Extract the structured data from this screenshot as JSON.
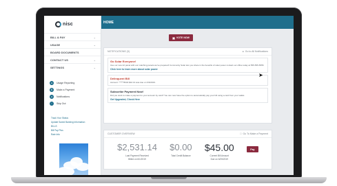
{
  "app": {
    "logo_text": "nisc",
    "page_title": "HOME"
  },
  "colors": {
    "brand_teal": "#1f6e8c",
    "accent_maroon": "#8b2a3e",
    "alert_red": "#c0392b"
  },
  "sidebar": {
    "nav_items": [
      {
        "label": "BILL & PAY",
        "has_chevron": true
      },
      {
        "label": "USAGE",
        "has_chevron": true
      },
      {
        "label": "BOARD DOCUMENTS",
        "has_chevron": false
      },
      {
        "label": "CONTACT US",
        "has_chevron": true
      },
      {
        "label": "SETTINGS",
        "has_chevron": true
      }
    ],
    "quick_actions": [
      {
        "label": "Usage Reporting",
        "icon": "chart-icon"
      },
      {
        "label": "Make a Payment",
        "icon": "dollar-icon"
      },
      {
        "label": "Notifications",
        "icon": "bell-icon"
      },
      {
        "label": "Skip Out",
        "icon": "arrow-icon"
      }
    ],
    "links": [
      "Track Your Status",
      "Update Saved Banking Information",
      "BILLS",
      "Bill Pay Plus",
      "Rate Info"
    ]
  },
  "main": {
    "vote_button_label": "VOTE NOW",
    "notifications": {
      "header": "NOTIFICATIONS (3)",
      "header_link": "Go to All Notifications",
      "items": [
        {
          "title": "Go Solar Everyone!",
          "body": "Use our new 22 panel with our matching panels we've prepared! Community Solar lets you share in the benefits of solar power contact our office today at 555-555-5555.",
          "link": "Click here to learn more about solar power"
        },
        {
          "title": "Delinquent Bill",
          "body": "Account: ******8034 $42.13 was due on 6/3/2019."
        },
        {
          "title": "Subscribe Payment Now!",
          "body": "Did you want to make a payment to your account by card? You can now have the option to automatically pay your bill using a card from your wallet.",
          "link": "Get Upgraded, Check Here"
        }
      ]
    },
    "overview": {
      "header": "CUSTOMER OVERVIEW",
      "header_link": "Go To Make a Payment",
      "amounts": [
        {
          "value": "$2,531.14",
          "label": "Last Payment Received",
          "sub": "Billed on 6/1/2019"
        },
        {
          "value": "$0.00",
          "label": "Total Credit Balance",
          "sub": ""
        },
        {
          "value": "$45.00",
          "label": "Current Bill Amount",
          "sub": "Due on 6/25/2019"
        }
      ],
      "pay_label": "Pay"
    }
  }
}
